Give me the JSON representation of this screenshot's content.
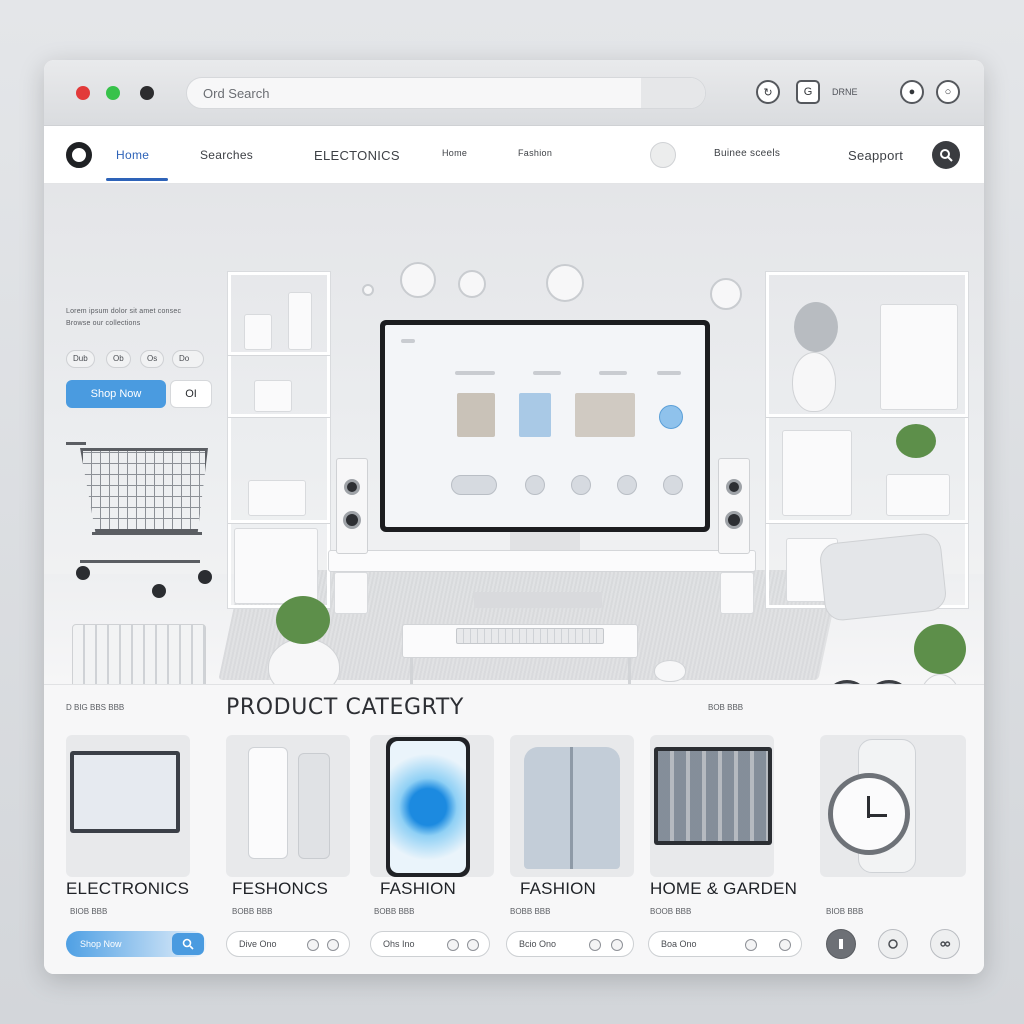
{
  "titlebar": {
    "address_text": "Ord Search",
    "right_text": "DRNE"
  },
  "nav": {
    "items": [
      {
        "label": "Home"
      },
      {
        "label": "Searches"
      },
      {
        "label": "ELECTONICS"
      },
      {
        "label": "Home"
      },
      {
        "label": "Fashion"
      },
      {
        "label": "Buinee sceels"
      },
      {
        "label": "Seapport"
      }
    ]
  },
  "hero": {
    "text_line_1": "Lorem ipsum dolor sit amet consec",
    "text_line_2": "Browse our collections",
    "chips": [
      "Dub",
      "Ob",
      "Os",
      "Do"
    ],
    "primary_button": "Shop Now",
    "secondary_button": "OI"
  },
  "products": {
    "meta_left": "D BIG BBS BBB",
    "meta_right": "BOB BBB",
    "title": "PRODUCT CATEGRTY",
    "categories": [
      {
        "label": "ELECTRONICS",
        "sub": "BIOB BBB"
      },
      {
        "label": "FESHONCS",
        "sub": "BOBB BBB"
      },
      {
        "label": "FASHION",
        "sub": "BOBB BBB"
      },
      {
        "label": "FASHION",
        "sub": "BOBB BBB"
      },
      {
        "label": "HOME & GARDEN",
        "sub": "BOOB BBB"
      },
      {
        "label": "",
        "sub": "BIOB BBB"
      }
    ],
    "pills": [
      "Dive Ono",
      "Ohs Ino",
      "Bcio Ono",
      "Boa Ono"
    ],
    "blue_pill": "Shop Now"
  },
  "colors": {
    "accent": "#4a9be0",
    "nav_active": "#2e63b8",
    "traffic_red": "#e23a3a",
    "traffic_green": "#37c24a"
  }
}
